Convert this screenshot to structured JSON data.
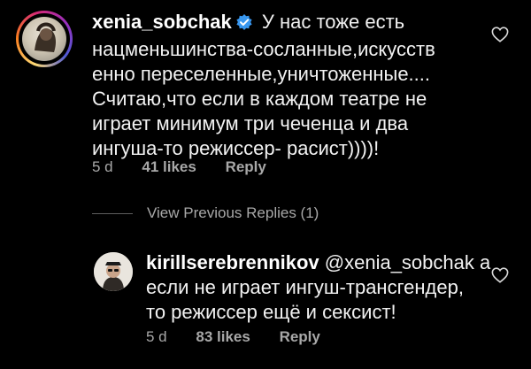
{
  "comment": {
    "username": "xenia_sobchak",
    "lines": [
      " У нас тоже есть",
      "нацменьшинства-сосланные,искусств",
      "енно переселенные,уничтоженные....",
      "Считаю,что если в каждом театре не",
      "играет минимум три чеченца и два",
      "ингуша-то режиссер- расист))))!"
    ],
    "time": "5 d",
    "likes": "41 likes",
    "reply_label": "Reply",
    "avatar_icon": "profile-photo",
    "verified_icon": "verified-badge-icon",
    "heart_icon": "heart-outline-icon"
  },
  "thread": {
    "view_previous": "View Previous Replies (1)"
  },
  "reply": {
    "username": "kirillserebrennikov",
    "mention": " @xenia_sobchak а",
    "lines": [
      "если не играет ингуш-трансгендер,",
      "то режиссер ещё и сексист!"
    ],
    "time": "5 d",
    "likes": "83 likes",
    "reply_label": "Reply",
    "avatar_icon": "profile-photo",
    "heart_icon": "heart-outline-icon"
  },
  "colors": {
    "background": "#000000",
    "text": "#f2f2f2",
    "secondary": "#a8a8a8",
    "verified": "#3897f0"
  }
}
